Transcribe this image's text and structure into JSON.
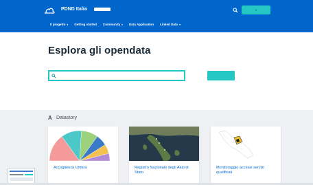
{
  "header": {
    "brand_name": "PDND Italia",
    "brand_url": "",
    "account_label": "",
    "colors": {
      "primary": "#0066cc",
      "accent": "#24c7c3"
    },
    "icons": {
      "logo": "cloud-logo-icon",
      "search": "search-icon"
    }
  },
  "nav": {
    "items": [
      {
        "label": "Il progetto",
        "has_caret": true
      },
      {
        "label": "Getting started",
        "has_caret": false
      },
      {
        "label": "Community",
        "has_caret": true
      },
      {
        "label": "Data Application",
        "has_caret": false
      },
      {
        "label": "Linked Data",
        "has_caret": true
      }
    ]
  },
  "hero": {
    "title": "Esplora gli opendata",
    "subtitle": "",
    "search": {
      "placeholder": "",
      "value": ""
    },
    "explore_label": "",
    "advanced_label": ""
  },
  "datastory": {
    "title": "Datastory",
    "cards": [
      {
        "title": "Accoglienza Umbra",
        "media": "pie-chart"
      },
      {
        "title": "Registro Nazionale degli Aiuti di Stato",
        "media": "italy-map"
      },
      {
        "title": "Monitoraggio accessi servizi qualificati",
        "media": "region-map"
      }
    ]
  },
  "chart_colors": [
    "#f59a9a",
    "#4dc8c8",
    "#9ad17a",
    "#3a79c8",
    "#f2c14e",
    "#b38bd8"
  ]
}
